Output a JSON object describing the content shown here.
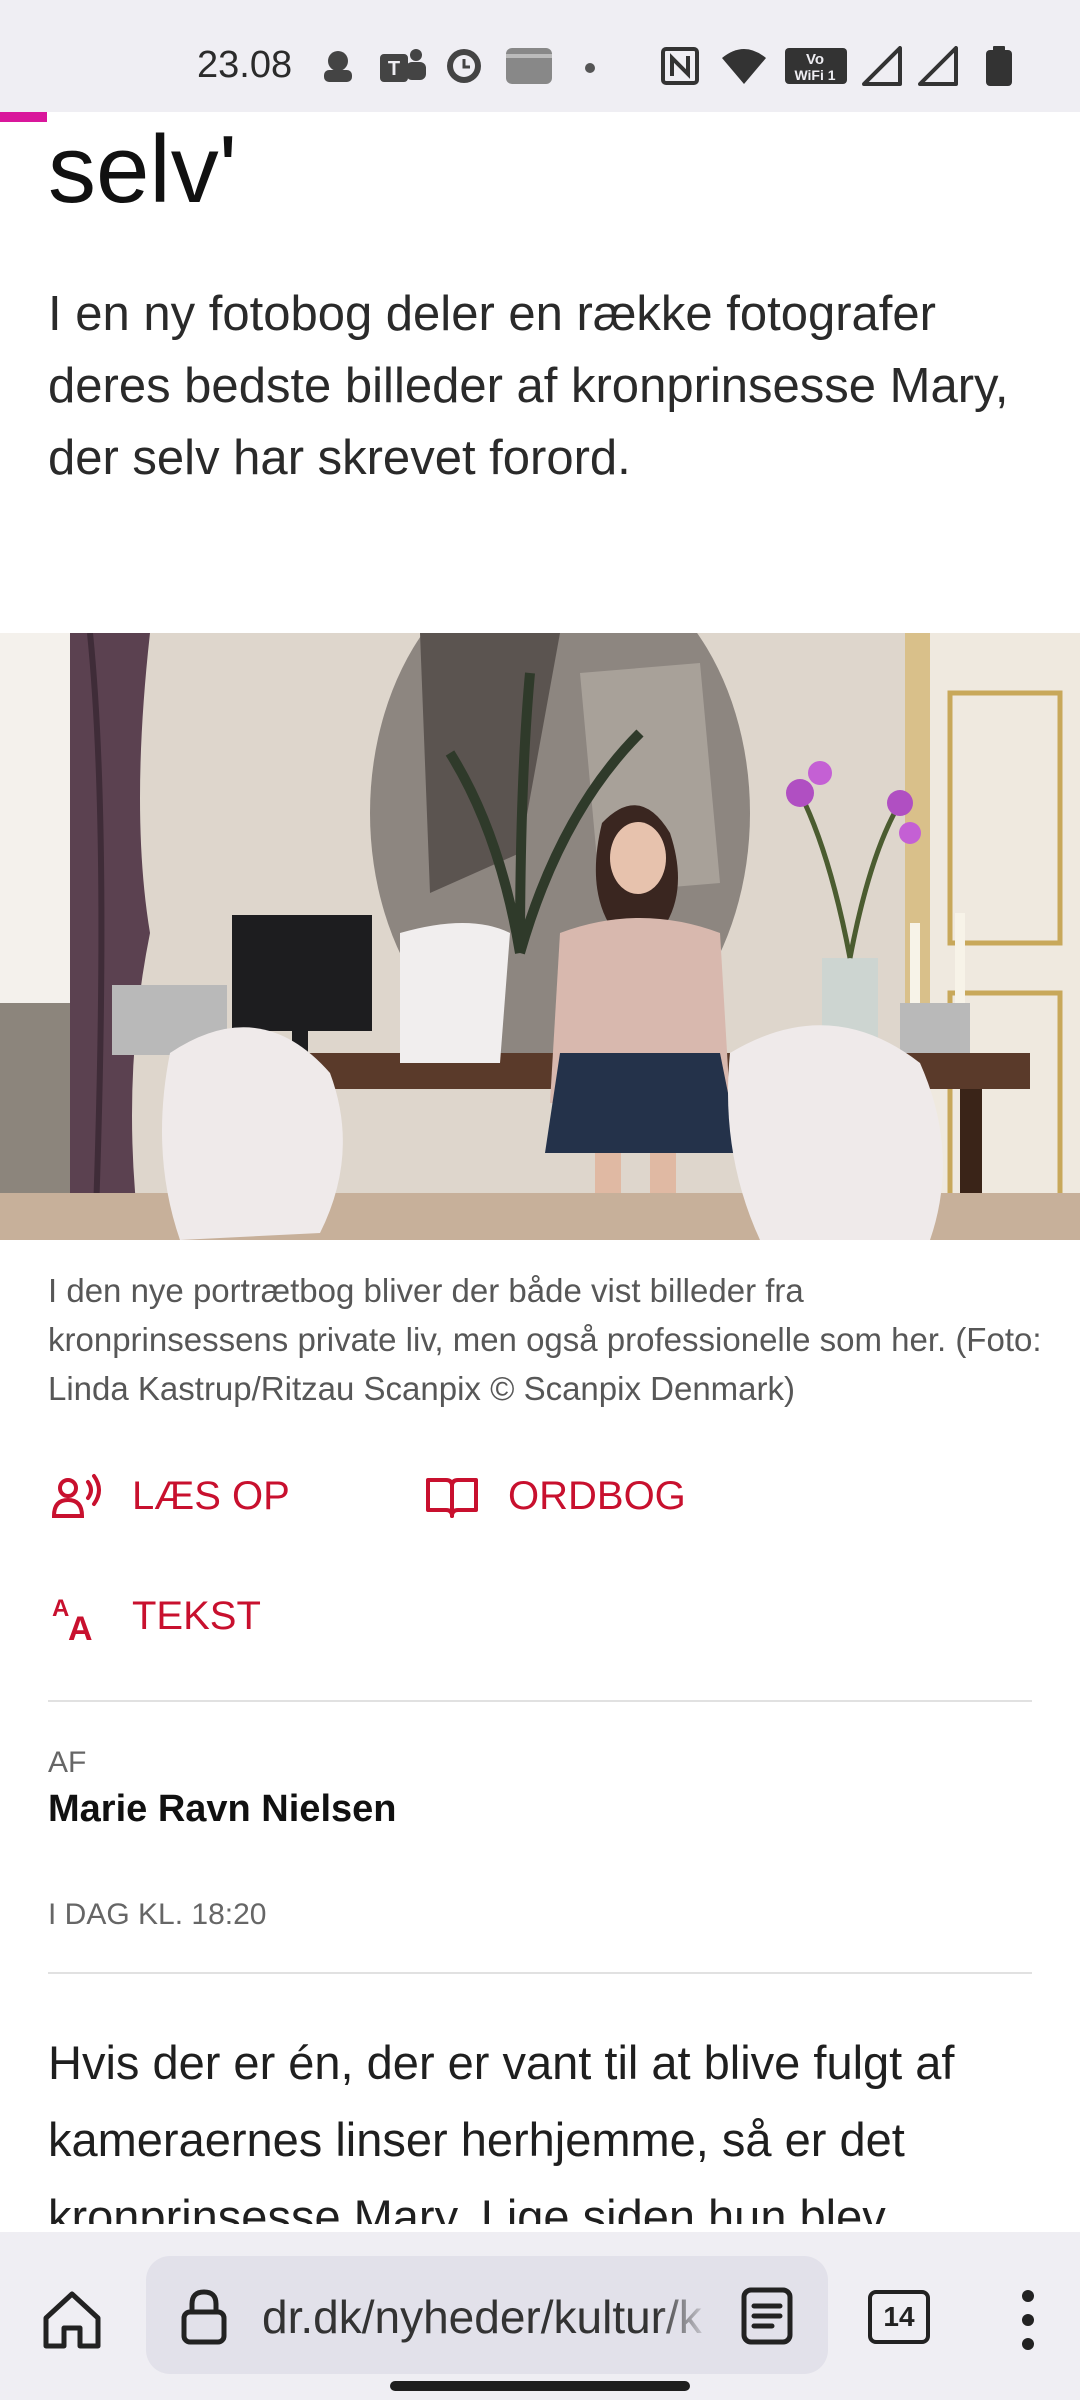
{
  "status_bar": {
    "time": "23.08",
    "icons": [
      "notification-icon",
      "teams-icon",
      "clock-app-icon",
      "card-icon",
      "dot-icon",
      "nfc-icon",
      "wifi-icon",
      "vowifi-icon",
      "signal-icon",
      "signal-icon-2",
      "battery-icon"
    ],
    "vowifi_top": "Vo",
    "vowifi_bottom": "WiFi 1"
  },
  "article": {
    "headline_tail": "selv'",
    "lead": "I en ny fotobog deler en række fotografer deres bedste billeder af kronprinsesse Mary, der selv har skrevet forord.",
    "image_caption": "I den nye portrætbog bliver der både vist billeder fra kronprinsessens private liv, men også professionelle som her. (Foto: Linda Kastrup/Ritzau Scanpix © Scanpix Denmark)",
    "actions": {
      "read_aloud": "LÆS OP",
      "dictionary": "ORDBOG",
      "text_size": "TEKST"
    },
    "byline_label": "AF",
    "author": "Marie Ravn Nielsen",
    "published": "I DAG KL. 18:20",
    "body": "Hvis der er én, der er vant til at blive fulgt af kameraernes linser herhjemme, så er det kronprinsesse Mary. Lige siden hun blev"
  },
  "browser": {
    "url": "dr.dk/nyheder/kultur/k",
    "tab_count": "14"
  },
  "colors": {
    "accent": "#c8102e",
    "progress": "#d9169b",
    "chrome_bg": "#efeef3"
  }
}
